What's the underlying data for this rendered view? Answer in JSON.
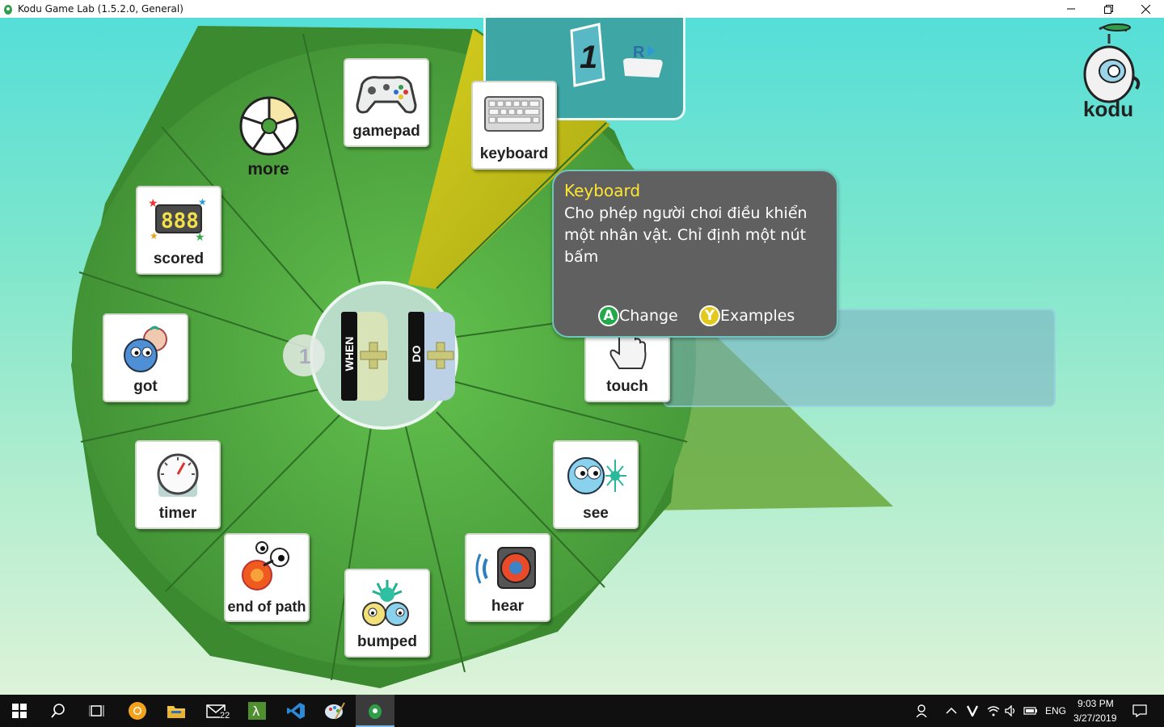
{
  "window": {
    "title": "Kodu Game Lab (1.5.2.0, General)",
    "controls": [
      "minimize",
      "maximize",
      "close"
    ]
  },
  "colors": {
    "wheel_green": "#4f9e3d",
    "selected_segment": "#c6c21c",
    "tooltip_bg": "#606060",
    "tooltip_title": "#ffe630",
    "button_a": "#23a84a",
    "button_y": "#e3c820"
  },
  "wheel": {
    "items": [
      {
        "label": "gamepad",
        "icon": "gamepad-icon"
      },
      {
        "label": "keyboard",
        "icon": "keyboard-icon",
        "selected": true
      },
      {
        "label": "more",
        "icon": "more-pie-icon"
      },
      {
        "label": "scored",
        "icon": "scoreboard-icon"
      },
      {
        "label": "got",
        "icon": "got-icon"
      },
      {
        "label": "timer",
        "icon": "timer-icon"
      },
      {
        "label": "end of path",
        "icon": "end-of-path-icon"
      },
      {
        "label": "bumped",
        "icon": "bumped-icon"
      },
      {
        "label": "hear",
        "icon": "speaker-icon"
      },
      {
        "label": "see",
        "icon": "see-icon"
      },
      {
        "label": "touch",
        "icon": "touch-hand-icon"
      }
    ]
  },
  "rule": {
    "when_label": "WHEN",
    "do_label": "DO",
    "number": "1"
  },
  "page_panel": {
    "page_number": "1",
    "button_hint": "R"
  },
  "tooltip": {
    "title": "Keyboard",
    "body": "Cho phép người chơi điều khiển một nhân vật. Chỉ định một nút bấm",
    "actions": [
      {
        "button": "A",
        "label": "Change"
      },
      {
        "button": "Y",
        "label": "Examples"
      }
    ]
  },
  "logo": {
    "text": "kodu"
  },
  "taskbar": {
    "apps": [
      "start",
      "search",
      "task-view",
      "chrome-canary",
      "file-explorer",
      "mail",
      "lambda-app",
      "vscode",
      "paint",
      "kodu"
    ],
    "mail_badge": "22",
    "tray": {
      "language": "ENG",
      "time": "9:03 PM",
      "date": "3/27/2019"
    }
  }
}
